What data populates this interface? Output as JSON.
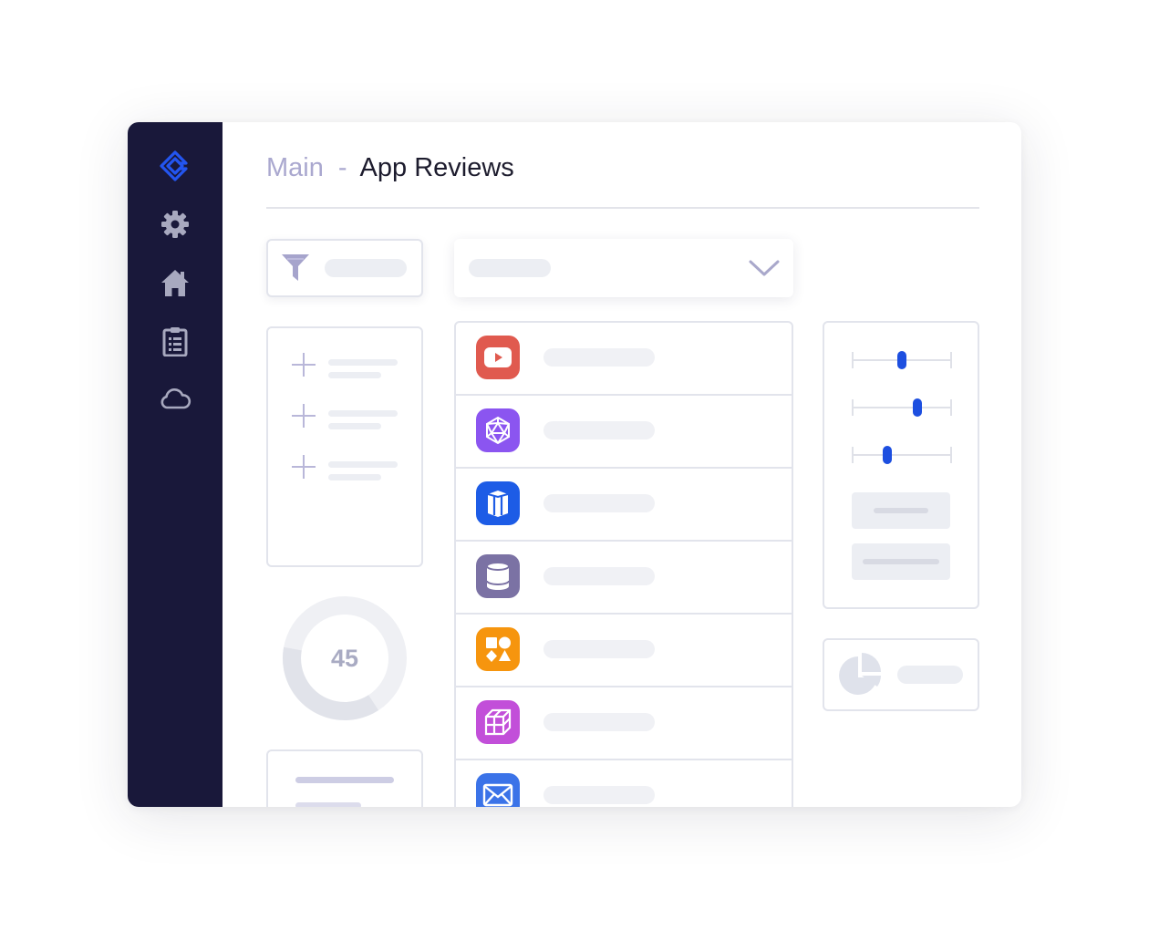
{
  "breadcrumb": {
    "root": "Main",
    "separator": "-",
    "current": "App Reviews"
  },
  "sidebar": {
    "items": [
      {
        "icon": "brand-logo-icon",
        "color": "#2355f0"
      },
      {
        "icon": "gear-icon",
        "color": "#a8a9bf"
      },
      {
        "icon": "home-icon",
        "color": "#a8a9bf"
      },
      {
        "icon": "clipboard-icon",
        "color": "#a8a9bf"
      },
      {
        "icon": "cloud-icon",
        "color": "#a8a9bf"
      }
    ]
  },
  "filter": {
    "icon": "filter-icon"
  },
  "dropdown": {
    "icon": "chevron-down-icon"
  },
  "apps": [
    {
      "icon": "youtube-play-icon",
      "color": "#e05a4f"
    },
    {
      "icon": "geodesic-sphere-icon",
      "color": "#8b55f0"
    },
    {
      "icon": "cylinder-pillar-icon",
      "color": "#1d5ce6"
    },
    {
      "icon": "database-cylinder-icon",
      "color": "#7b72a4"
    },
    {
      "icon": "shapes-icon",
      "color": "#f6950e"
    },
    {
      "icon": "cube-grid-icon",
      "color": "#c24fd9"
    },
    {
      "icon": "mail-icon",
      "color": "#3b73e8"
    }
  ],
  "gauge": {
    "value": "45",
    "fraction": 0.37
  },
  "sliders": [
    {
      "position": 0.5
    },
    {
      "position": 0.65
    },
    {
      "position": 0.35
    }
  ],
  "colors": {
    "sidebar_bg": "#19183a",
    "accent": "#1d4fe0",
    "muted_text": "#aaa8cf"
  }
}
